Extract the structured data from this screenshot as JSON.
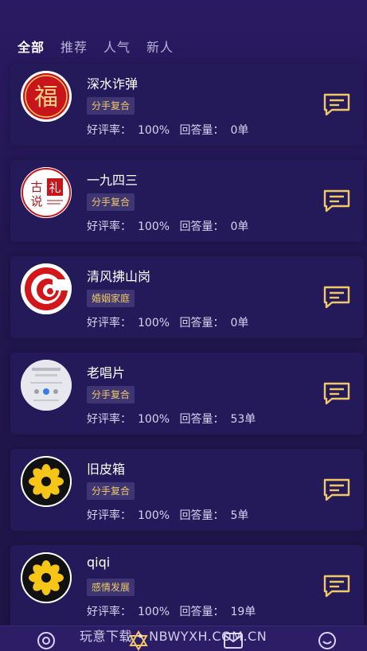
{
  "tabs": [
    {
      "label": "全部",
      "active": true
    },
    {
      "label": "推荐",
      "active": false
    },
    {
      "label": "人气",
      "active": false
    },
    {
      "label": "新人",
      "active": false
    }
  ],
  "labels": {
    "rating_prefix": "好评率：",
    "answers_prefix": "回答量："
  },
  "experts": [
    {
      "name": "深水诈弹",
      "tag": "分手复合",
      "rating": "100%",
      "answers": "0单",
      "avatar": "fu-seal-avatar"
    },
    {
      "name": "一九四三",
      "tag": "分手复合",
      "rating": "100%",
      "answers": "0单",
      "avatar": "ancient-ritual-seal-avatar"
    },
    {
      "name": "清风拂山岗",
      "tag": "婚姻家庭",
      "rating": "100%",
      "answers": "0单",
      "avatar": "red-swirl-avatar"
    },
    {
      "name": "老唱片",
      "tag": "分手复合",
      "rating": "100%",
      "answers": "53单",
      "avatar": "music-player-avatar"
    },
    {
      "name": "旧皮箱",
      "tag": "分手复合",
      "rating": "100%",
      "answers": "5单",
      "avatar": "yellow-lotus-avatar"
    },
    {
      "name": "qiqi",
      "tag": "感情发展",
      "rating": "100%",
      "answers": "19单",
      "avatar": "yellow-lotus-avatar"
    }
  ],
  "avatar_text": {
    "fu": "福",
    "gu": "古",
    "li": "礼",
    "shuo": "说"
  },
  "watermark": "玩意下载 • NBWYXH.COM.CN",
  "bottom_nav": [
    {
      "icon": "eye-icon"
    },
    {
      "icon": "star-of-david-icon"
    },
    {
      "icon": "message-card-icon"
    },
    {
      "icon": "smile-icon"
    }
  ],
  "colors": {
    "accent": "#f2c867",
    "card": "#241a5a",
    "background": "#22164f"
  }
}
